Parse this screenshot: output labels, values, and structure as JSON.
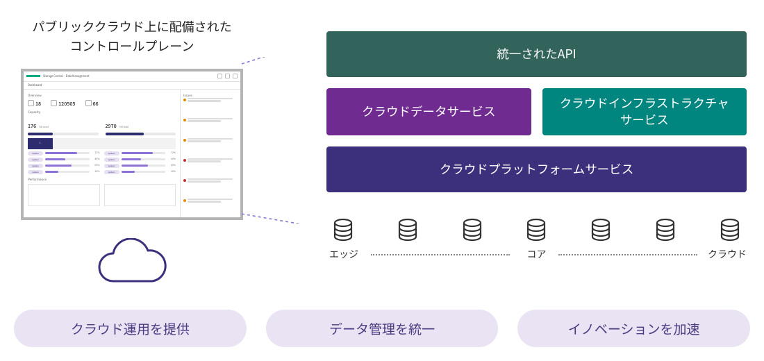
{
  "left": {
    "title_line1": "パブリッククラウド上に配備された",
    "title_line2": "コントロールプレーン",
    "dashboard": {
      "brand_title": "Storage Central  ·  Data Management",
      "page_label": "Dashboard",
      "overview_label": "Overview",
      "stat1": "18",
      "stat2": "120505",
      "stat3": "66",
      "capacity_label": "Capacity",
      "cap1_value": "176",
      "cap1_unit": "TiB used",
      "cap1_fill_pct": 35,
      "cap2_value": "2970",
      "cap2_unit": "TiB total",
      "cap2_fill_pct": 55,
      "tab_active": "1",
      "list_rows": [
        {
          "chip": "system",
          "fill_pct": 72,
          "pct": "72%"
        },
        {
          "chip": "system",
          "fill_pct": 45,
          "pct": "45%"
        },
        {
          "chip": "system",
          "fill_pct": 60,
          "pct": "60%"
        },
        {
          "chip": "system",
          "fill_pct": 30,
          "pct": "30%"
        }
      ],
      "performance_label": "Performance",
      "issues_label": "Issues",
      "alert_colors": [
        "#e08a00",
        "#e08a00",
        "#e08a00",
        "#c22f2f",
        "#c22f2f",
        "#e08a00"
      ]
    }
  },
  "blocks": {
    "api": "統一されたAPI",
    "data": "クラウドデータサービス",
    "infra_line1": "クラウドインフラストラクチャ",
    "infra_line2": "サービス",
    "plat": "クラウドプラットフォームサービス"
  },
  "db_labels": {
    "edge": "エッジ",
    "core": "コア",
    "cloud": "クラウド"
  },
  "pills": {
    "p1": "クラウド運用を提供",
    "p2": "データ管理を統一",
    "p3": "イノベーションを加速"
  },
  "colors": {
    "purple_stroke": "#3c307c",
    "dash": "#8c72d6"
  }
}
